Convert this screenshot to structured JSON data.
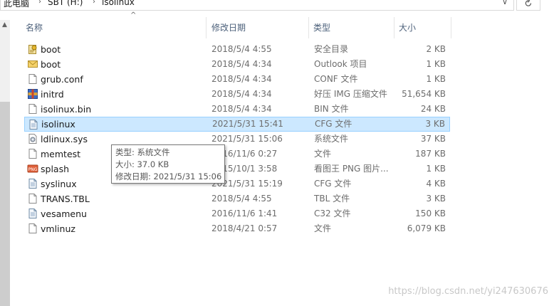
{
  "breadcrumb": {
    "items": [
      "此电脑",
      "SBT (H:)",
      "isolinux"
    ]
  },
  "columns": {
    "name": "名称",
    "date": "修改日期",
    "type": "类型",
    "size": "大小"
  },
  "files": [
    {
      "name": "boot",
      "date": "2018/5/4 4:55",
      "type": "安全目录",
      "size": "2 KB",
      "icon": "security-catalog-icon"
    },
    {
      "name": "boot",
      "date": "2018/5/4 4:34",
      "type": "Outlook 项目",
      "size": "1 KB",
      "icon": "outlook-item-icon"
    },
    {
      "name": "grub.conf",
      "date": "2018/5/4 4:34",
      "type": "CONF 文件",
      "size": "1 KB",
      "icon": "file-icon"
    },
    {
      "name": "initrd",
      "date": "2018/5/4 4:34",
      "type": "好压 IMG 压缩文件",
      "size": "51,654 KB",
      "icon": "archive-icon"
    },
    {
      "name": "isolinux.bin",
      "date": "2018/5/4 4:34",
      "type": "BIN 文件",
      "size": "24 KB",
      "icon": "file-icon"
    },
    {
      "name": "isolinux",
      "date": "2021/5/31 15:41",
      "type": "CFG 文件",
      "size": "3 KB",
      "icon": "text-file-icon",
      "selected": true
    },
    {
      "name": "ldlinux.sys",
      "date": "2021/5/31 15:06",
      "type": "系统文件",
      "size": "37 KB",
      "icon": "system-file-icon"
    },
    {
      "name": "memtest",
      "date": "2016/11/6 0:27",
      "type": "文件",
      "size": "187 KB",
      "icon": "file-icon"
    },
    {
      "name": "splash",
      "date": "2015/10/1 3:58",
      "type": "看图王 PNG 图片...",
      "size": "1 KB",
      "icon": "png-image-icon"
    },
    {
      "name": "syslinux",
      "date": "2021/5/31 15:19",
      "type": "CFG 文件",
      "size": "4 KB",
      "icon": "text-file-icon"
    },
    {
      "name": "TRANS.TBL",
      "date": "2018/5/4 4:55",
      "type": "TBL 文件",
      "size": "3 KB",
      "icon": "file-icon"
    },
    {
      "name": "vesamenu",
      "date": "2016/11/6 1:41",
      "type": "C32 文件",
      "size": "150 KB",
      "icon": "text-file-icon"
    },
    {
      "name": "vmlinuz",
      "date": "2018/4/21 0:57",
      "type": "文件",
      "size": "6,079 KB",
      "icon": "file-icon"
    }
  ],
  "tooltip": {
    "type_line": "类型: 系统文件",
    "size_line": "大小: 37.0 KB",
    "date_line": "修改日期: 2021/5/31 15:06"
  },
  "watermark": "https://blog.csdn.net/yi247630676",
  "colors": {
    "selection_bg": "#cce8ff",
    "selection_border": "#99d1ff",
    "header_text": "#4c607a"
  }
}
